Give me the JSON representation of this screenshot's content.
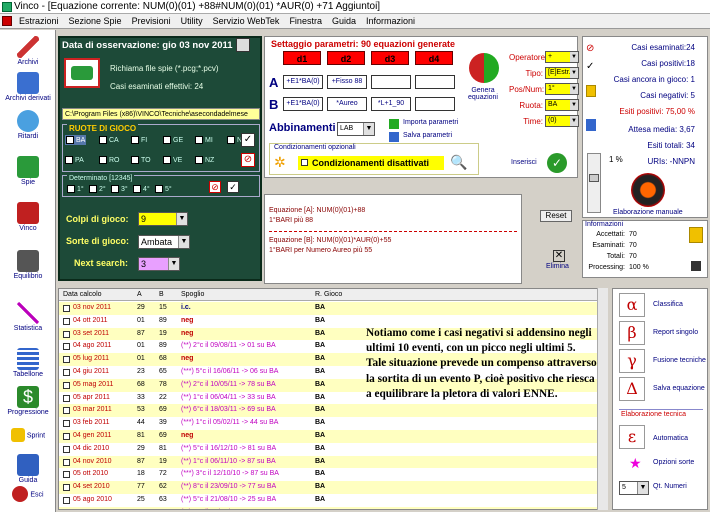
{
  "window": {
    "title": "Vinco - [Equazione corrente: NUM(0)(01) +88#NUM(0)(01) *AUR(0) +71 Aggiuntoi]"
  },
  "menu": [
    "Estrazioni",
    "Sezione Spie",
    "Previsioni",
    "Utility",
    "Servizio WebTek",
    "Finestra",
    "Guida",
    "Informazioni"
  ],
  "leftbar": [
    "Archivi",
    "Archivi derivati",
    "Ritardi",
    "Spie",
    "Vinco",
    "Equilibrio",
    "Statistica",
    "Tabellone",
    "Progressione",
    "Sprint",
    "Guida",
    "Esci"
  ],
  "observation": {
    "title": "Data di osservazione: gio 03 nov 2011",
    "spie_label": "Richiama file spie (*.pcg;*.pcv)",
    "casi_label": "Casi esaminati effettivi: 24",
    "path": "C:\\Program Files (x86)\\VINCO\\Tecniche\\asecondadelmese",
    "ruote_title": "RUOTE DI GIOCO",
    "ruote": [
      "BA",
      "CA",
      "FI",
      "GE",
      "MI",
      "NA",
      "PA",
      "RO",
      "TO",
      "VE",
      "NZ",
      ""
    ],
    "determinato_title": "Determinato [12345]",
    "determinato": [
      "1°",
      "2°",
      "3°",
      "4°",
      "5°"
    ],
    "colpi_label": "Colpi di gioco:",
    "colpi_value": "9",
    "sorte_label": "Sorte di gioco:",
    "sorte_value": "Ambata",
    "next_label": "Next search:",
    "next_value": "3"
  },
  "params": {
    "title": "Settaggio parametri: 90 equazioni generate",
    "d": [
      "d1",
      "d2",
      "d3",
      "d4"
    ],
    "rowA": [
      "+E1*BA(0)",
      "+Fisso 88",
      "",
      ""
    ],
    "rowB": [
      "+E1*BA(0)",
      "*Aureo",
      "*L+1_90",
      ""
    ],
    "genera": "Genera equazioni",
    "abbinamenti": "Abbinamenti",
    "abbin_value": "LAB",
    "importa": "Importa parametri",
    "salva": "Salva parametri",
    "cond_title": "Condizionamenti opzionali",
    "cond_value": "Condizionamenti disattivati",
    "inserisci": "Inserisci",
    "op_labels": [
      "Operatore:",
      "Tipo:",
      "Pos/Num:",
      "Ruota:",
      "Time:"
    ],
    "op_values": [
      "+",
      "[E]Estr.",
      "1°",
      "BA",
      "(0)"
    ]
  },
  "equations": {
    "a1": "Equazione [A]: NUM(0)(01)+88",
    "a2": "1°BARI  più 88",
    "b1": "Equazione [B]: NUM(0)(01)*AUR(0)+55",
    "b2": "1°BARI per  Numero Aureo  più 55",
    "reset": "Reset",
    "elimina": "Elimina"
  },
  "stats": {
    "rows": [
      "Casi esaminati:24",
      "Casi positivi:18",
      "Casi ancora in gioco: 1",
      "Casi negativi: 5",
      "Esiti positivi: 75,00 %",
      "Attesa media: 3,67",
      "Esiti totali: 34",
      "URIs: -NNPN"
    ],
    "pct": "1 %",
    "elab": "Elaborazione manuale"
  },
  "info": {
    "title": "Informazioni",
    "accettati": "Accettati:",
    "accettati_v": "70",
    "esaminati": "Esaminati:",
    "esaminati_v": "70",
    "totali": "Totali:",
    "totali_v": "70",
    "processing": "Processing:",
    "processing_v": "100 %"
  },
  "table": {
    "headers": [
      "Data calcolo",
      "A",
      "B",
      "Spoglio",
      "R. Gioco"
    ],
    "rows": [
      [
        "03 nov 2011",
        "29",
        "15",
        "i.c.",
        "BA"
      ],
      [
        "04 ott 2011",
        "01",
        "89",
        "neg",
        "BA"
      ],
      [
        "03 set 2011",
        "87",
        "19",
        "neg",
        "BA"
      ],
      [
        "04 ago 2011",
        "01",
        "89",
        "(**) 2°c il 09/08/11 -> 01 su BA",
        "BA"
      ],
      [
        "05 lug 2011",
        "01",
        "68",
        "neg",
        "BA"
      ],
      [
        "04 giu 2011",
        "23",
        "65",
        "(***) 5°c il 16/06/11 -> 06 su BA",
        "BA"
      ],
      [
        "05 mag 2011",
        "68",
        "78",
        "(**) 2°c il 10/05/11 -> 78 su BA",
        "BA"
      ],
      [
        "05 apr 2011",
        "33",
        "22",
        "(**) 1°c il 06/04/11 -> 33 su BA",
        "BA"
      ],
      [
        "03 mar 2011",
        "53",
        "69",
        "(**) 6°c il 18/03/11 -> 69 su BA",
        "BA"
      ],
      [
        "03 feb 2011",
        "44",
        "39",
        "(***) 1°c il 05/02/11 -> 44 su BA",
        "BA"
      ],
      [
        "04 gen 2011",
        "81",
        "69",
        "neg",
        "BA"
      ],
      [
        "04 dic 2010",
        "29",
        "81",
        "(**) 5°c il 16/12/10 -> 81 su BA",
        "BA"
      ],
      [
        "04 nov 2010",
        "87",
        "19",
        "(**) 1°c il 06/11/10 -> 87 su BA",
        "BA"
      ],
      [
        "05 ott 2010",
        "18",
        "72",
        "(***) 3°c il 12/10/10 -> 87 su BA",
        "BA"
      ],
      [
        "04 set 2010",
        "77",
        "62",
        "(**) 8°c il 23/09/10 -> 77 su BA",
        "BA"
      ],
      [
        "05 ago 2010",
        "25",
        "63",
        "(**) 5°c il 21/08/10 -> 25 su BA",
        "BA"
      ],
      [
        "03 lug 2010",
        "63",
        "59",
        "(**) 2°c il 08/07/10 -> 05 su BA",
        "BA"
      ]
    ]
  },
  "note": "Notiamo come i casi negativi si addensino negli ultimi 10 eventi, con un picco negli ultimi 5. Tale situazione prevede un compenso attraverso la sortita di un evento P, cioè positivo che riesca a equilibrare la pletora di valori ENNE.",
  "right": {
    "greek": [
      [
        "α",
        "Classifica"
      ],
      [
        "β",
        "Report singolo"
      ],
      [
        "γ",
        "Fusione tecniche"
      ],
      [
        "Δ",
        "Salva equazione"
      ]
    ],
    "elab_title": "Elaborazione tecnica",
    "auto": [
      "ε",
      "Automatica"
    ],
    "opzioni": "Opzioni sorte",
    "qt_value": "5",
    "qt_label": "Qt. Numeri"
  },
  "colors": {
    "red": "#cc0000",
    "navy": "#000080",
    "yellow": "#ffff00",
    "green": "#1d4a38"
  }
}
